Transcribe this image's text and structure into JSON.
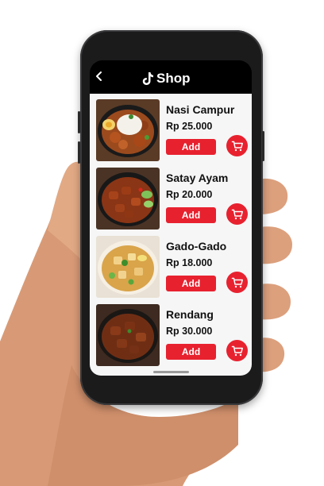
{
  "header": {
    "title": "Shop",
    "back_icon": "chevron-left-icon",
    "brand_icon": "tiktok-note-icon"
  },
  "products": [
    {
      "name": "Nasi Campur",
      "price": "Rp 25.000",
      "add_label": "Add",
      "cart_icon": "cart-icon"
    },
    {
      "name": "Satay Ayam",
      "price": "Rp 20.000",
      "add_label": "Add",
      "cart_icon": "cart-icon"
    },
    {
      "name": "Gado-Gado",
      "price": "Rp 18.000",
      "add_label": "Add",
      "cart_icon": "cart-icon"
    },
    {
      "name": "Rendang",
      "price": "Rp 30.000",
      "add_label": "Add",
      "cart_icon": "cart-icon"
    }
  ],
  "colors": {
    "accent": "#e8212f",
    "header_bg": "#000000",
    "screen_bg": "#f6f6f6"
  }
}
